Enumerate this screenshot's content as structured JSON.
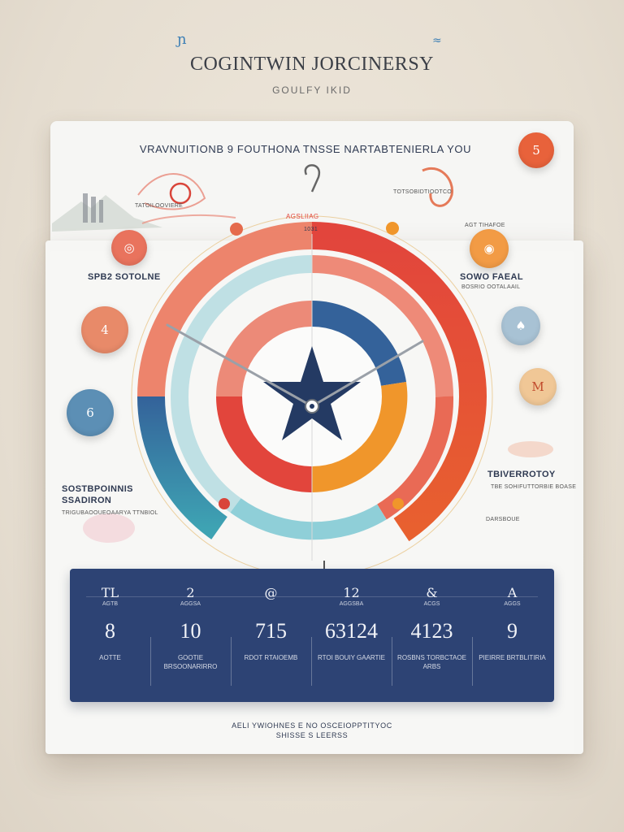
{
  "header": {
    "title": "COGINTWIN JORCINERSY",
    "subtitle": "GOULFY IKID"
  },
  "card": {
    "headline": "VRAVNUITIONB 9 FOUTHONA TNSSE NARTABTENIERLA YOU",
    "center_label": "AGSLIIAG",
    "center_sub": "1031"
  },
  "labels": {
    "left_1": "SPB2 SOTOLNE",
    "right_1": "SOWO FAEAL",
    "right_1_sub": "BOSRIO OOTALAAIL",
    "left_2_line1": "SOSTBPOINNIS",
    "left_2_line2": "SSADIRON",
    "left_2_sub": "TRIGUBAOOUEOAARYA TTNBIOL",
    "right_2": "TBIVERROTOY",
    "right_2_sub": "TBE SOHIFUTTORBIE BOASE",
    "right_3": "DARSBOUE",
    "top_right_note": "TOTSOBIDTIOOTCO",
    "top_left_note": "TATOILOOVIERE",
    "right_small": "AGT TIHAFOE"
  },
  "bubbles": {
    "top_right": "5",
    "left_orange": "4",
    "left_blue": "6",
    "right_gold": "M"
  },
  "stats": [
    {
      "icon": "TL",
      "caption": "AGTB",
      "value": "8",
      "sub": "AOTTE"
    },
    {
      "icon": "2",
      "caption": "AGGSA",
      "value": "10",
      "sub": "GOOTIE  BRSOONARIRRO"
    },
    {
      "icon": "@",
      "caption": "",
      "value": "715",
      "sub": "RDOT  RTAIOEMB"
    },
    {
      "icon": "12",
      "caption": "AGGSBA",
      "value": "63124",
      "sub": "RTOI  BOUIY  GAARTIE"
    },
    {
      "icon": "&",
      "caption": "ACGS",
      "value": "4123",
      "sub": "ROSBNS  TORBCTAOE  ARBS"
    },
    {
      "icon": "A",
      "caption": "AGGS",
      "value": "9",
      "sub": "PIEIRRE  BRTBLITIRIA"
    }
  ],
  "footer": {
    "line1": "AELI YWIOHNES E NO OSCEIOPPTITYOC",
    "line2": "SHISSE S LEERSS"
  },
  "colors": {
    "red": "#e2453c",
    "coral": "#ec7a5f",
    "navy": "#2d4374",
    "teal": "#3ea3b3",
    "orange": "#f0962b",
    "cream": "#f6f6f4"
  }
}
